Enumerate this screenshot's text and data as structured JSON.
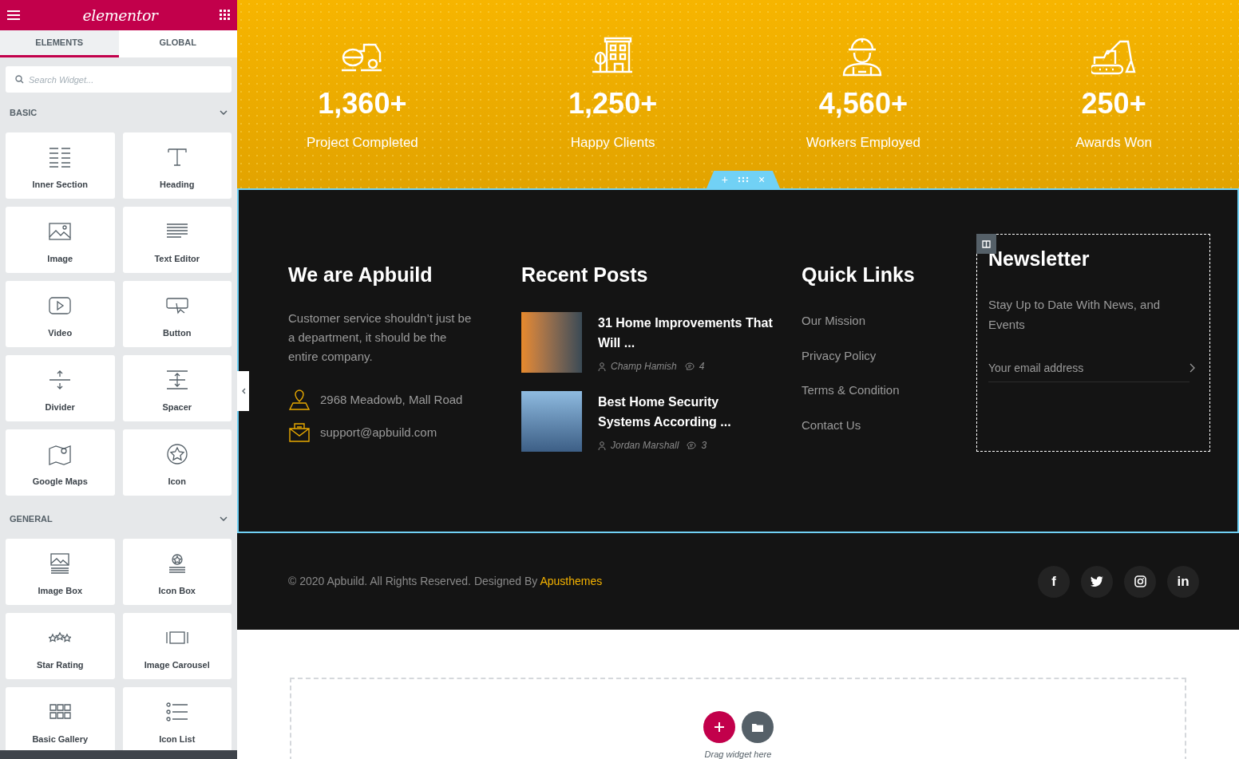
{
  "sidebar": {
    "logo": "elementor",
    "tabs": [
      {
        "label": "ELEMENTS",
        "selected": true
      },
      {
        "label": "GLOBAL",
        "selected": false
      }
    ],
    "search": {
      "placeholder": "Search Widget..."
    },
    "categories": [
      {
        "title": "BASIC",
        "expanded": true,
        "widgets": [
          {
            "label": "Inner Section",
            "kind": "columns"
          },
          {
            "label": "Heading",
            "kind": "heading"
          },
          {
            "label": "Image",
            "kind": "image"
          },
          {
            "label": "Text Editor",
            "kind": "text"
          },
          {
            "label": "Video",
            "kind": "video"
          },
          {
            "label": "Button",
            "kind": "button"
          },
          {
            "label": "Divider",
            "kind": "divider"
          },
          {
            "label": "Spacer",
            "kind": "spacer"
          },
          {
            "label": "Google Maps",
            "kind": "map"
          },
          {
            "label": "Icon",
            "kind": "star-circle"
          }
        ]
      },
      {
        "title": "GENERAL",
        "expanded": true,
        "widgets": [
          {
            "label": "Image Box",
            "kind": "imagebox"
          },
          {
            "label": "Icon Box",
            "kind": "iconbox"
          },
          {
            "label": "Star Rating",
            "kind": "stars"
          },
          {
            "label": "Image Carousel",
            "kind": "carousel"
          },
          {
            "label": "Basic Gallery",
            "kind": "gallery"
          },
          {
            "label": "Icon List",
            "kind": "list"
          }
        ]
      }
    ]
  },
  "stats": [
    {
      "kind": "roller",
      "value": "1,360+",
      "label": "Project Completed"
    },
    {
      "kind": "building",
      "value": "1,250+",
      "label": "Happy Clients"
    },
    {
      "kind": "worker",
      "value": "4,560+",
      "label": "Workers Employed"
    },
    {
      "kind": "excavator",
      "value": "250+",
      "label": "Awards Won"
    }
  ],
  "section_handle": [
    "+",
    "×"
  ],
  "footer": {
    "about": {
      "title": "We are Apbuild",
      "text": "Customer service shouldn’t just be a department, it should be the entire company.",
      "address": "2968 Meadowb, Mall Road",
      "email": "support@apbuild.com"
    },
    "recent_posts": {
      "title": "Recent Posts",
      "posts": [
        {
          "title": "31 Home Improvements That Will ...",
          "author": "Champ Hamish",
          "comments": "4"
        },
        {
          "title": "Best Home Security Systems According ...",
          "author": "Jordan Marshall",
          "comments": "3"
        }
      ]
    },
    "quick_links": {
      "title": "Quick Links",
      "links": [
        "Our Mission",
        "Privacy Policy",
        "Terms & Condition",
        "Contact Us"
      ]
    },
    "newsletter": {
      "title": "Newsletter",
      "text": "Stay Up to Date With News, and Events",
      "placeholder": "Your email address"
    }
  },
  "bottom_bar": {
    "copyright": "© 2020 Apbuild. All Rights Reserved. Designed By",
    "brand": "Apusthemes",
    "social": [
      {
        "kind": "facebook",
        "label": "f"
      },
      {
        "kind": "twitter"
      },
      {
        "kind": "instagram"
      },
      {
        "kind": "linkedin",
        "label": "in"
      }
    ]
  },
  "drop_area": {
    "hint": "Drag widget here"
  }
}
